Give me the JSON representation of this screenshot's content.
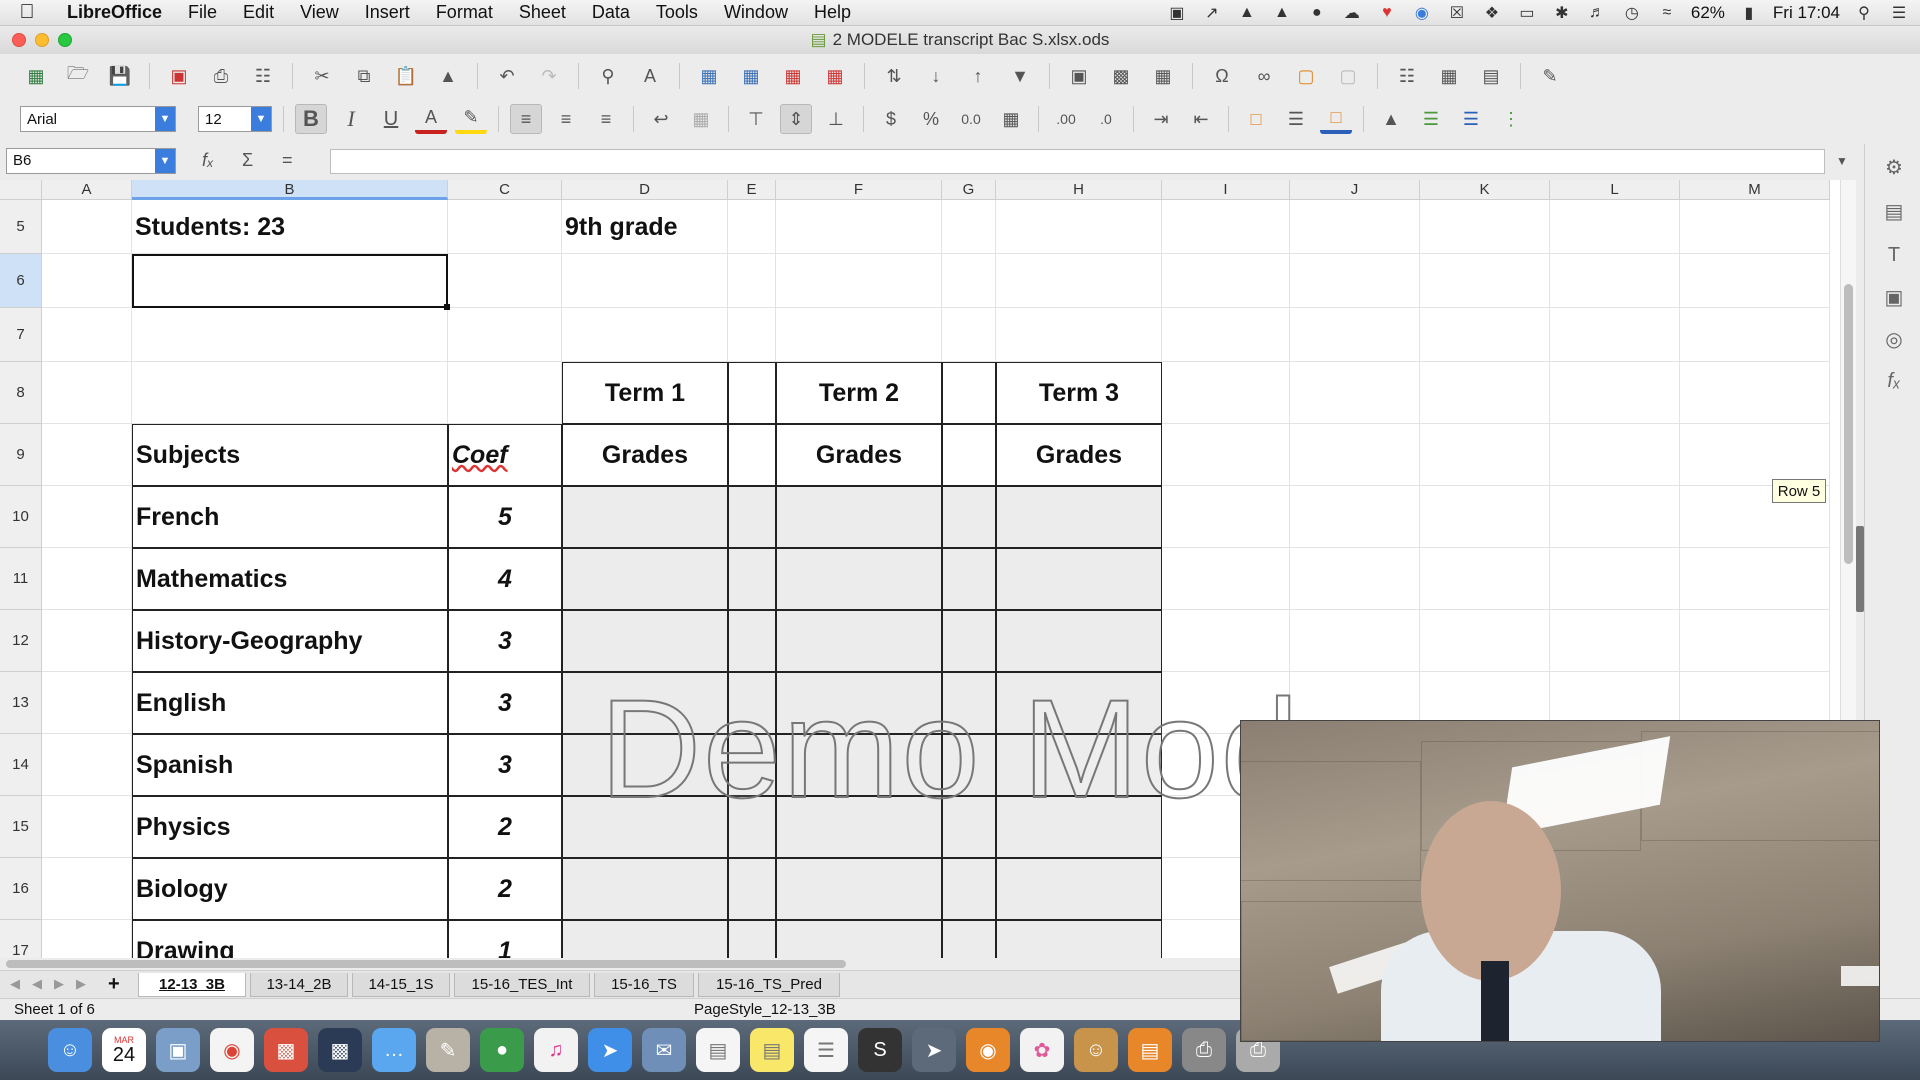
{
  "menubar": {
    "app": "LibreOffice",
    "items": [
      "File",
      "Edit",
      "View",
      "Insert",
      "Format",
      "Sheet",
      "Data",
      "Tools",
      "Window",
      "Help"
    ],
    "battery": "62%",
    "clock": "Fri 17:04"
  },
  "window": {
    "title": "2 MODELE transcript Bac S.xlsx.ods"
  },
  "format_toolbar": {
    "font_name": "Arial",
    "font_size": "12"
  },
  "formula_bar": {
    "cell_ref": "B6",
    "content": ""
  },
  "columns": [
    "A",
    "B",
    "C",
    "D",
    "E",
    "F",
    "G",
    "H",
    "I",
    "J",
    "K",
    "L",
    "M"
  ],
  "rows": [
    "5",
    "6",
    "7",
    "8",
    "9",
    "10",
    "11",
    "12",
    "13",
    "14",
    "15",
    "16",
    "17"
  ],
  "sheet": {
    "students": "Students: 23",
    "grade_level": "9th grade",
    "terms": [
      "Term 1",
      "Term 2",
      "Term 3"
    ],
    "subjects_header": "Subjects",
    "coef_header": "Coef",
    "grades_header": "Grades",
    "subjects": [
      {
        "name": "French",
        "coef": "5"
      },
      {
        "name": "Mathematics",
        "coef": "4"
      },
      {
        "name": "History-Geography",
        "coef": "3"
      },
      {
        "name": "English",
        "coef": "3"
      },
      {
        "name": "Spanish",
        "coef": "3"
      },
      {
        "name": "Physics",
        "coef": "2"
      },
      {
        "name": "Biology",
        "coef": "2"
      },
      {
        "name": "Drawing",
        "coef": "1"
      }
    ]
  },
  "watermark": "Demo Mode",
  "row_tooltip": "Row 5",
  "tabs": {
    "active": "12-13_3B",
    "items": [
      "12-13_3B",
      "13-14_2B",
      "14-15_1S",
      "15-16_TES_Int",
      "15-16_TS",
      "15-16_TS_Pred"
    ]
  },
  "statusbar": {
    "sheet_info": "Sheet 1 of 6",
    "page_style": "PageStyle_12-13_3B"
  },
  "dock": {
    "calendar_month": "MAR",
    "calendar_day": "24",
    "apps": [
      "finder-icon",
      "calendar-icon",
      "preview-icon",
      "chrome-icon",
      "keynote-icon",
      "activity-icon",
      "messages-icon",
      "notes-icon",
      "evernote-icon",
      "itunes-icon",
      "safari-icon",
      "mail-icon",
      "document-icon",
      "stickies-icon",
      "reminders-icon",
      "skype-icon",
      "launchpad-icon",
      "globe-icon",
      "photos-icon",
      "contacts-icon",
      "ibooks-icon",
      "scanner-icon",
      "printer-icon"
    ]
  }
}
